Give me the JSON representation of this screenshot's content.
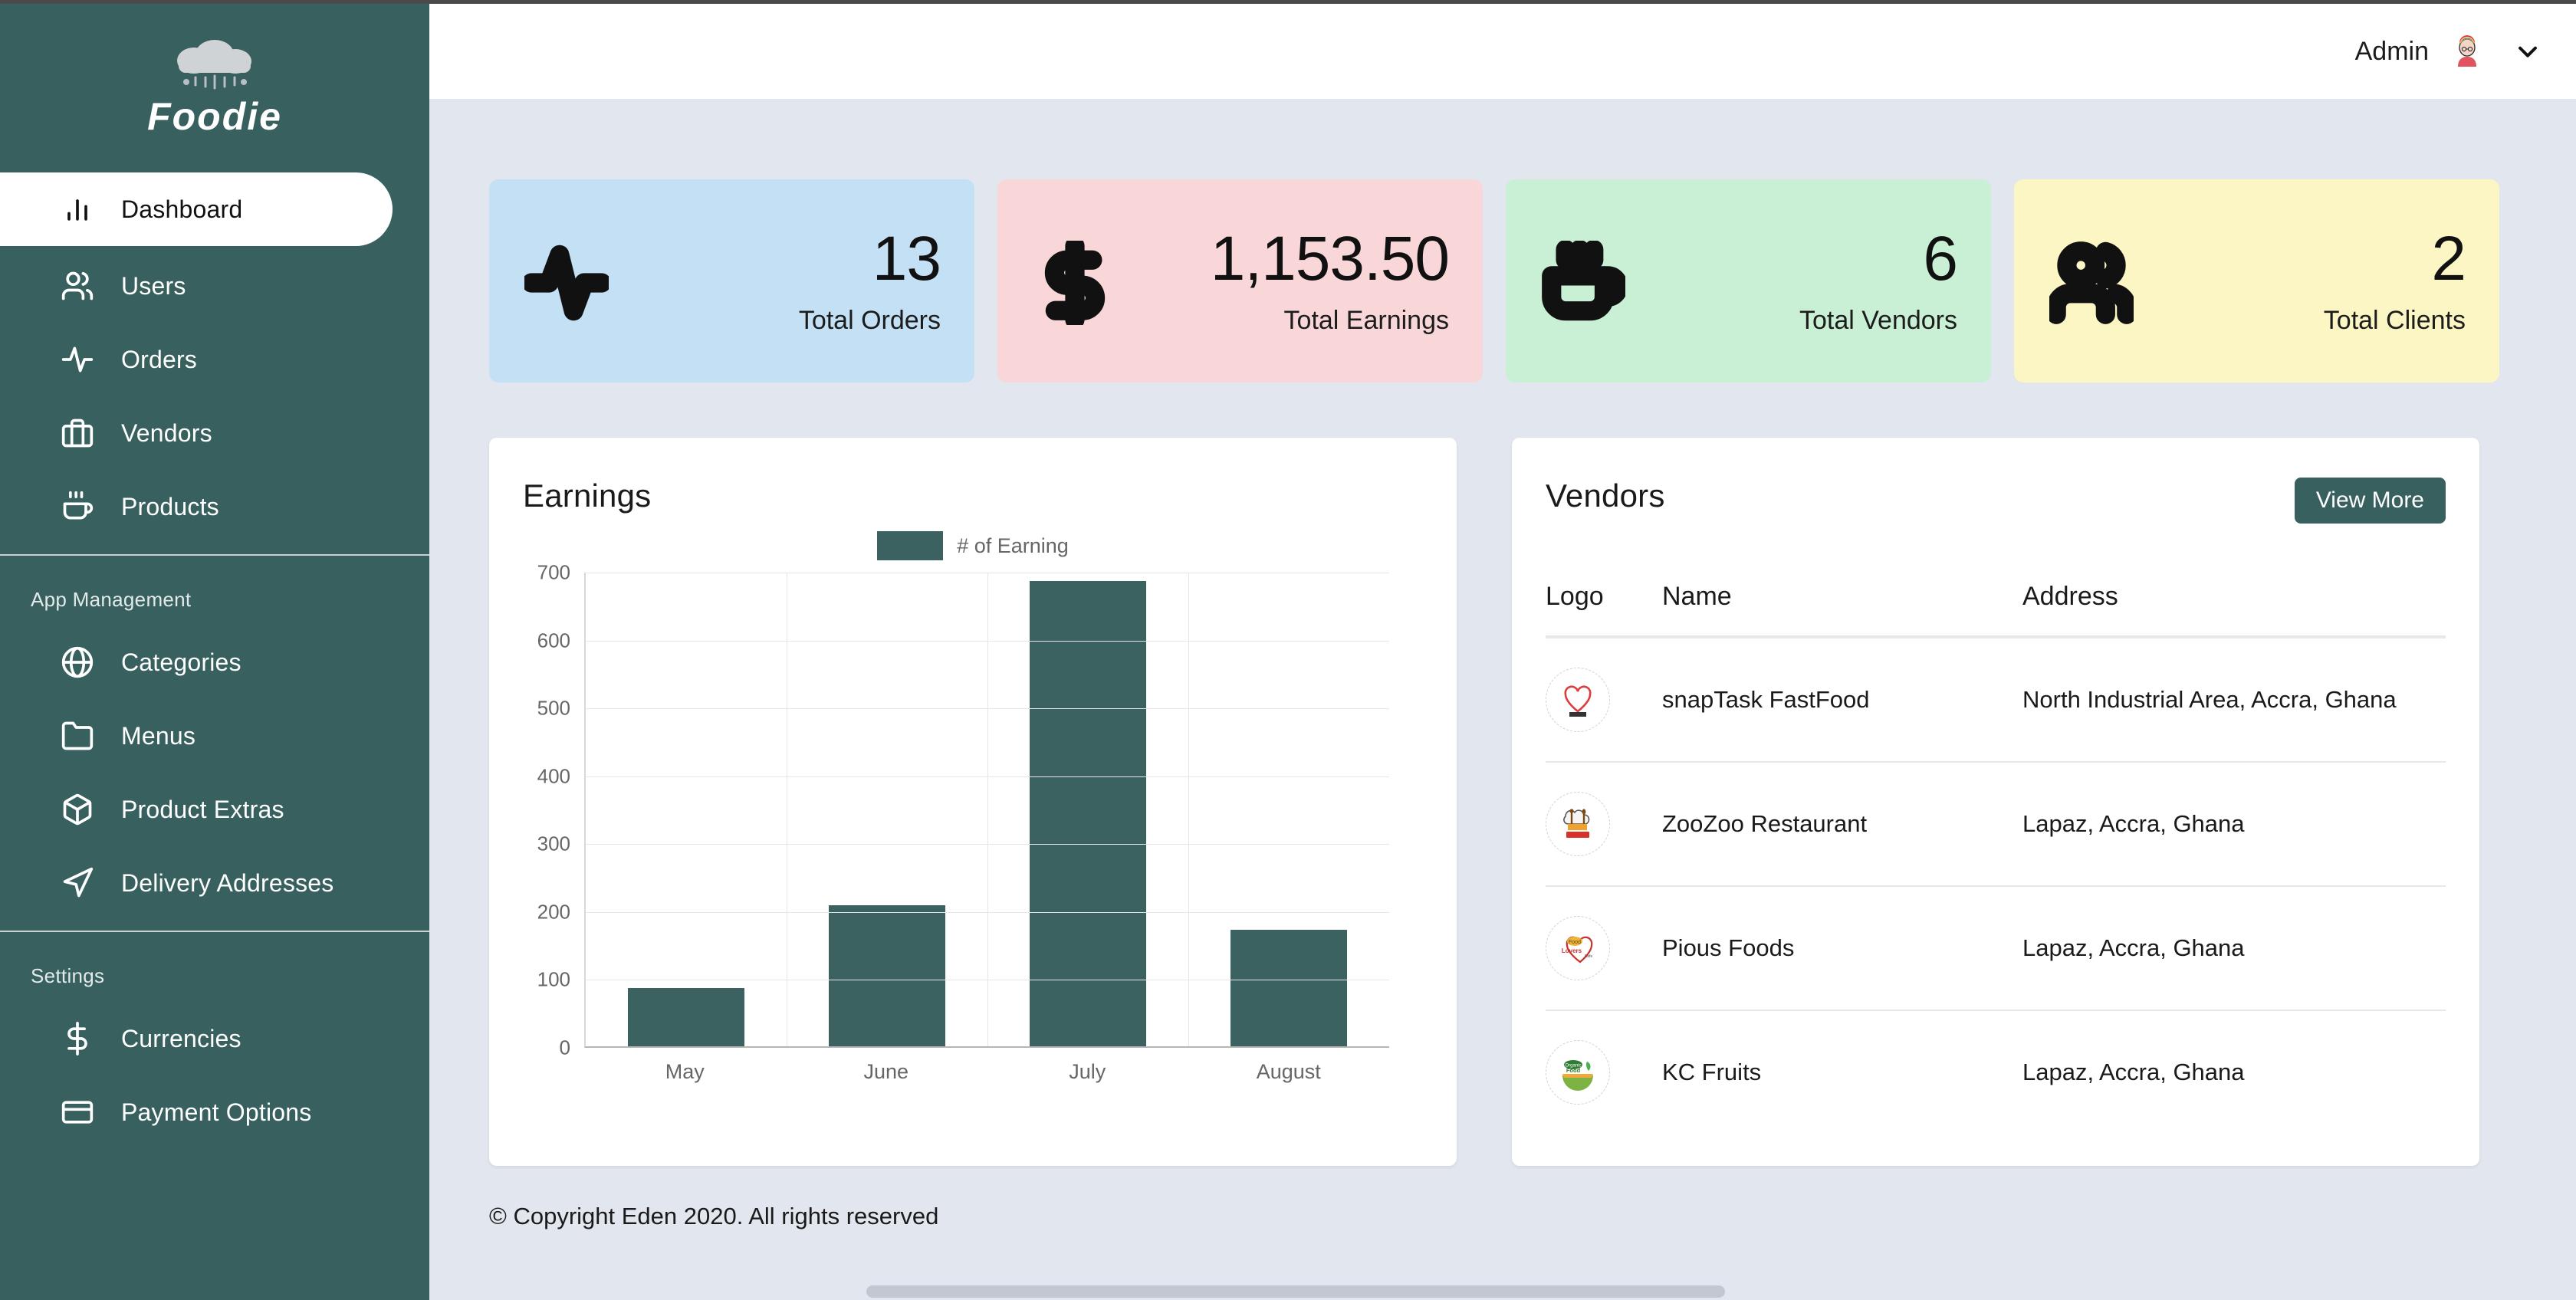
{
  "app": {
    "brand": "Foodie"
  },
  "header": {
    "admin_label": "Admin",
    "avatar_icon": "person-rainbow-hair-avatar",
    "chevron_icon": "chevron-down-icon"
  },
  "sidebar": {
    "main_items": [
      {
        "label": "Dashboard",
        "icon": "bar-chart-icon",
        "active": true
      },
      {
        "label": "Users",
        "icon": "users-icon",
        "active": false
      },
      {
        "label": "Orders",
        "icon": "activity-pulse-icon",
        "active": false
      },
      {
        "label": "Vendors",
        "icon": "briefcase-icon",
        "active": false
      },
      {
        "label": "Products",
        "icon": "coffee-cup-icon",
        "active": false
      }
    ],
    "app_management": {
      "label": "App Management",
      "items": [
        {
          "label": "Categories",
          "icon": "globe-icon"
        },
        {
          "label": "Menus",
          "icon": "folder-icon"
        },
        {
          "label": "Product Extras",
          "icon": "package-box-icon"
        },
        {
          "label": "Delivery Addresses",
          "icon": "send-navigation-icon"
        }
      ]
    },
    "settings": {
      "label": "Settings",
      "items": [
        {
          "label": "Currencies",
          "icon": "dollar-sign-icon"
        },
        {
          "label": "Payment Options",
          "icon": "credit-card-icon"
        }
      ]
    }
  },
  "stats": [
    {
      "value": "13",
      "label": "Total Orders",
      "icon": "activity-pulse-icon",
      "bg": "#c3e0f5"
    },
    {
      "value": "1,153.50",
      "label": "Total Earnings",
      "icon": "dollar-sign-icon",
      "bg": "#f9d7d9"
    },
    {
      "value": "6",
      "label": "Total Vendors",
      "icon": "coffee-cup-icon",
      "bg": "#c9f0d4"
    },
    {
      "value": "2",
      "label": "Total Clients",
      "icon": "users-icon",
      "bg": "#fbf6c3"
    }
  ],
  "earnings_panel": {
    "title": "Earnings"
  },
  "chart_data": {
    "type": "bar",
    "title": "Earnings",
    "categories": [
      "May",
      "June",
      "July",
      "August"
    ],
    "values": [
      86,
      208,
      685,
      172
    ],
    "series": [
      {
        "name": "# of Earning",
        "values": [
          86,
          208,
          685,
          172
        ]
      }
    ],
    "legend": [
      "# of Earning"
    ],
    "legend_position": "top-center",
    "bar_color": "#3b6160",
    "xlabel": "",
    "ylabel": "",
    "ylim": [
      0,
      700
    ],
    "yticks": [
      0,
      100,
      200,
      300,
      400,
      500,
      600,
      700
    ],
    "grid": true
  },
  "vendors_panel": {
    "title": "Vendors",
    "view_more_label": "View More",
    "columns": [
      "Logo",
      "Name",
      "Address"
    ],
    "rows": [
      {
        "logo": "heart-foodlover-logo",
        "name": "snapTask FastFood",
        "address": "North Industrial Area, Accra, Ghana"
      },
      {
        "logo": "chef-hat-logo",
        "name": "ZooZoo Restaurant",
        "address": "Lapaz, Accra, Ghana"
      },
      {
        "logo": "food-lovers-cafe-logo",
        "name": "Pious Foods",
        "address": "Lapaz, Accra, Ghana"
      },
      {
        "logo": "organic-food-logo",
        "name": "KC Fruits",
        "address": "Lapaz, Accra, Ghana"
      }
    ]
  },
  "footer": {
    "copyright": "© Copyright Eden 2020. All rights reserved"
  },
  "theme": {
    "sidebar_bg": "#37605f",
    "accent": "#3b6160",
    "page_bg": "#e2e6ee",
    "panel_bg": "#ffffff"
  }
}
